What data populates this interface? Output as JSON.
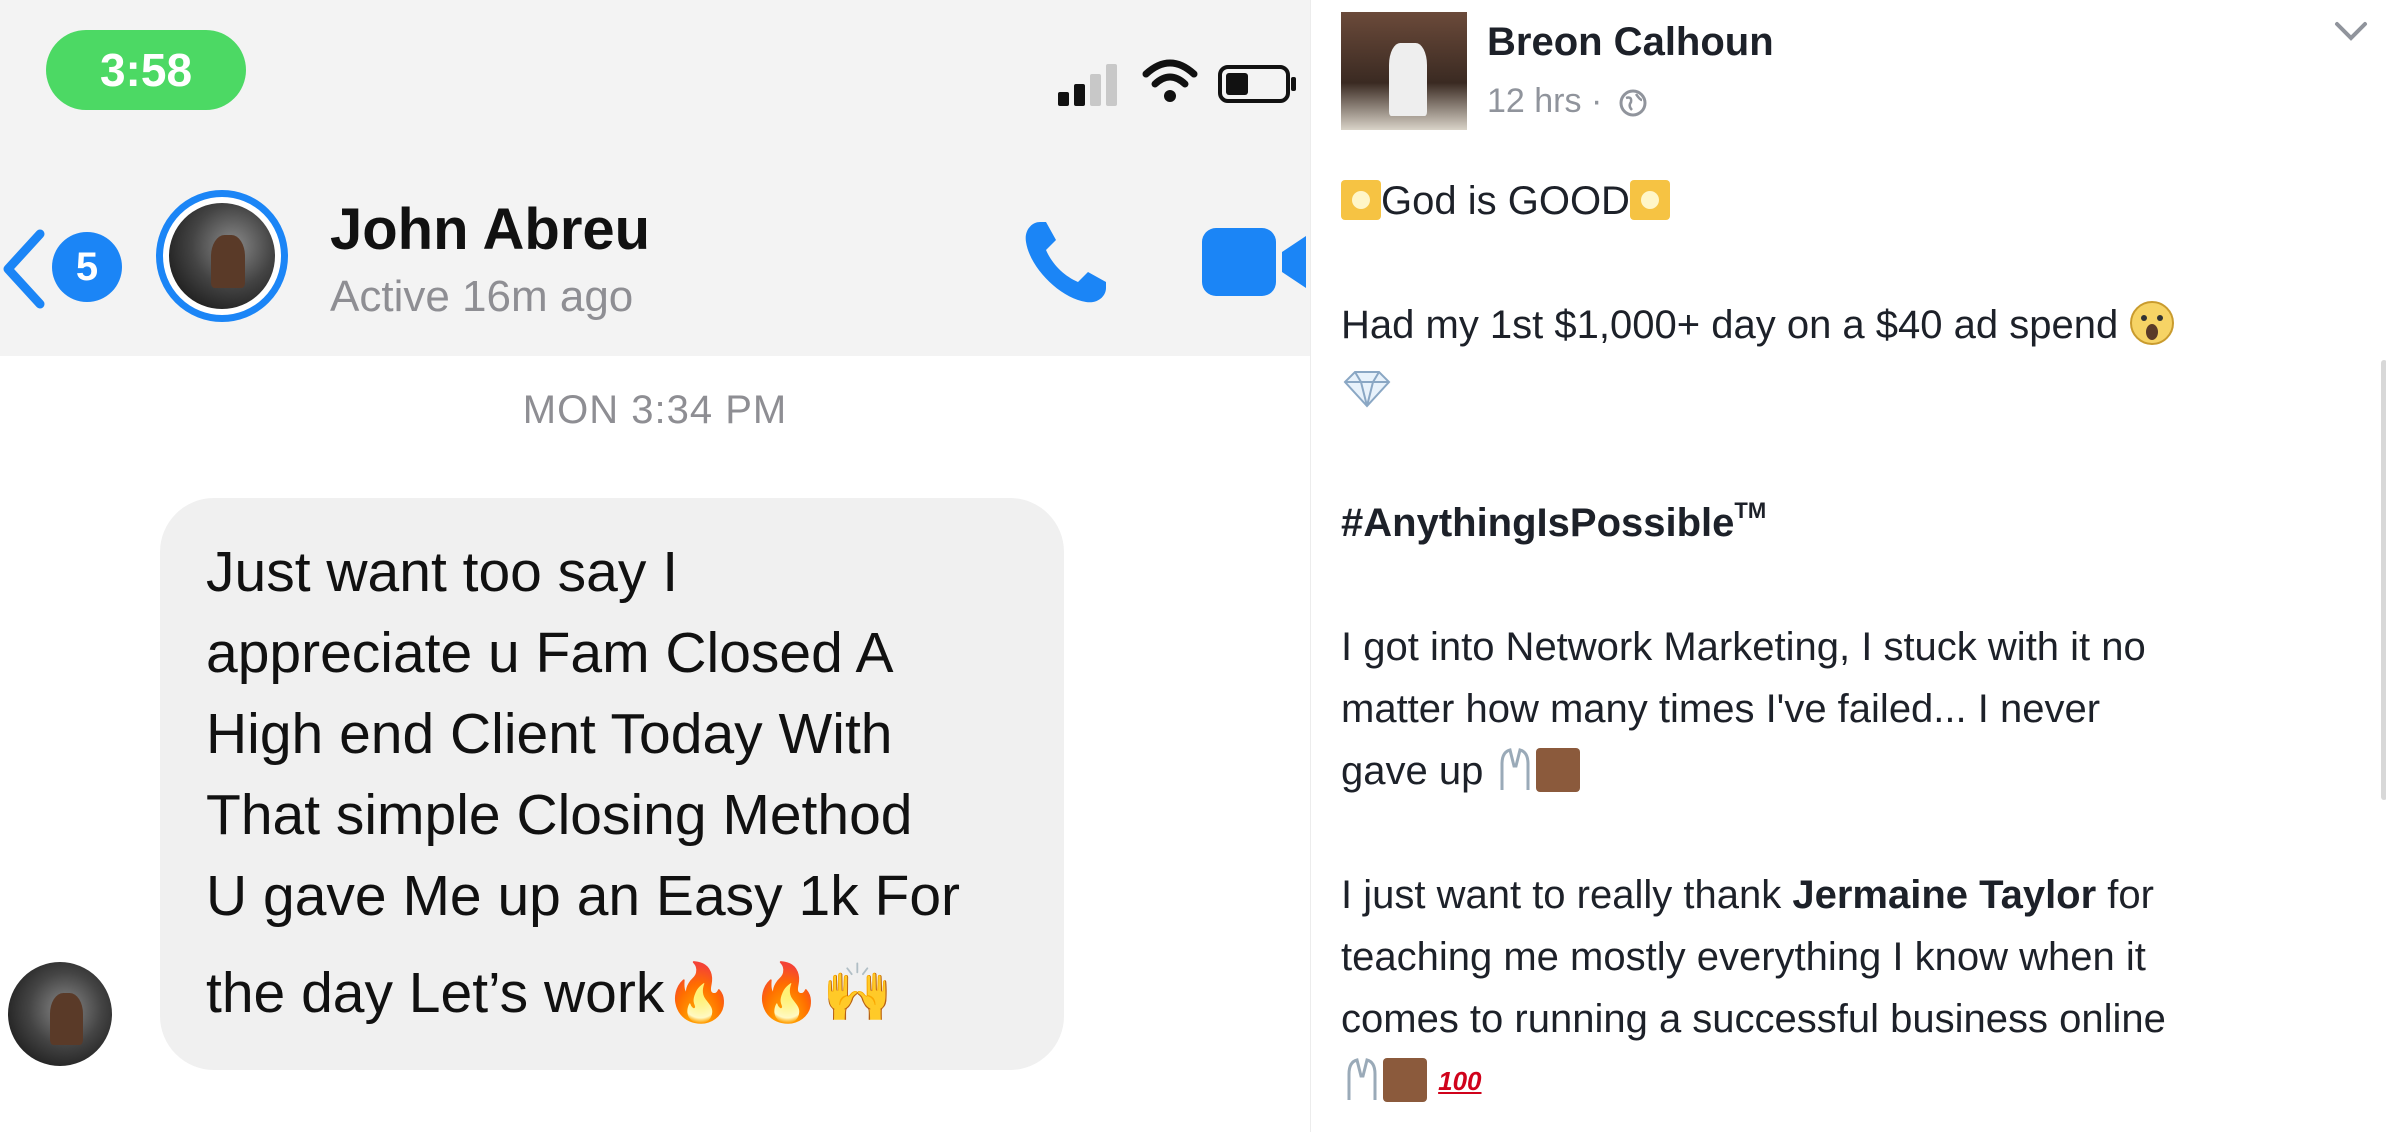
{
  "status_bar": {
    "time": "3:58"
  },
  "messenger": {
    "back_badge": "5",
    "contact_name": "John Abreu",
    "contact_status": "Active 16m ago",
    "timestamp": "MON 3:34 PM",
    "message_lines": [
      "Just want too say I",
      "appreciate u Fam Closed A",
      "High end Client Today With",
      "That simple Closing Method",
      "U gave Me up an Easy 1k For",
      "the day Let’s work"
    ],
    "message_emojis": "🔥 🔥🙌"
  },
  "post": {
    "author": "Breon Calhoun",
    "meta": "12 hrs ·",
    "headline": "God is GOOD",
    "line_spend": "Had my 1st $1,000+ day on a $40 ad spend",
    "hashtag": "#AnythingIsPossible",
    "hashtag_mark": "TM",
    "para1_line1": "I got into Network Marketing, I stuck with it no",
    "para1_line2": "matter how many times I've failed... I never",
    "para1_line3": "gave up",
    "para2_pre": "I just want to really thank ",
    "para2_name": "Jermaine Taylor",
    "para2_line1_post": " for",
    "para2_line2": "teaching me mostly everything I know when it",
    "para2_line3": "comes to running a successful business online",
    "hundred": "100"
  }
}
